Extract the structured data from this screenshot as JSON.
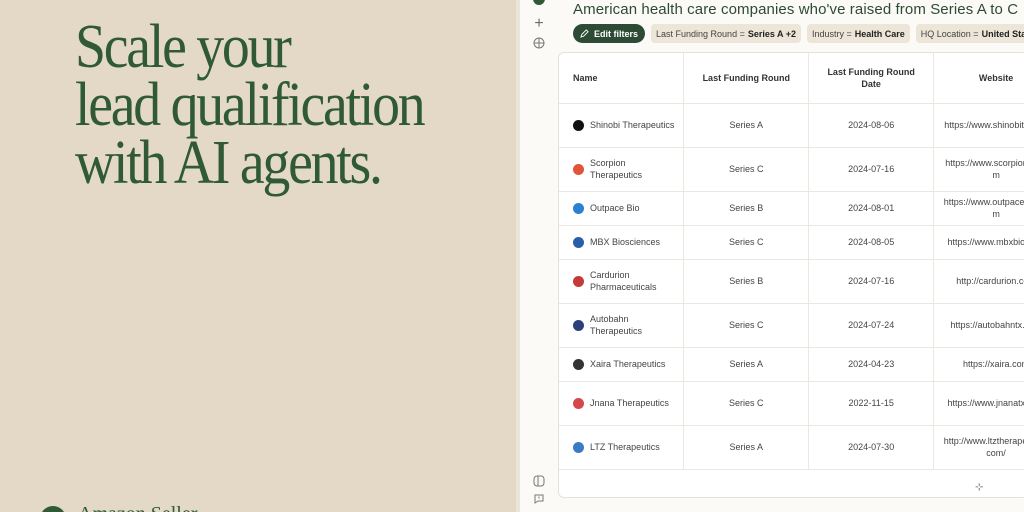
{
  "hero": {
    "line1": "Scale your",
    "line2": "lead qualification",
    "line3": "with AI agents.",
    "brand": "Amazon Seller"
  },
  "app": {
    "title": "American health care companies who've raised from Series A to C",
    "filters": {
      "edit_label": "Edit filters",
      "chips": [
        {
          "key": "Last Funding Round =",
          "value": "Series A +2"
        },
        {
          "key": "Industry =",
          "value": "Health Care"
        },
        {
          "key": "HQ Location =",
          "value": "United States"
        }
      ]
    },
    "table": {
      "columns": [
        "Name",
        "Last Funding Round",
        "Last Funding Round Date",
        "Website"
      ],
      "rows": [
        {
          "name": "Shinobi Therapeutics",
          "round": "Series A",
          "date": "2024-08-06",
          "website": "https://www.shinobitx.com",
          "logo": "shinobi-logo",
          "logo_color": "#111111"
        },
        {
          "name": "Scorpion Therapeutics",
          "round": "Series C",
          "date": "2024-07-16",
          "website": "https://www.scorpiontx.com",
          "logo": "scorpion-logo",
          "logo_color": "#e0553a"
        },
        {
          "name": "Outpace Bio",
          "round": "Series B",
          "date": "2024-08-01",
          "website": "https://www.outpacebio.com",
          "logo": "outpace-logo",
          "logo_color": "#2d7fd0"
        },
        {
          "name": "MBX Biosciences",
          "round": "Series C",
          "date": "2024-08-05",
          "website": "https://www.mbxbio.com",
          "logo": "mbx-logo",
          "logo_color": "#2a5ea8"
        },
        {
          "name": "Cardurion Pharmaceuticals",
          "round": "Series B",
          "date": "2024-07-16",
          "website": "http://cardurion.com",
          "logo": "cardurion-logo",
          "logo_color": "#c43a3a"
        },
        {
          "name": "Autobahn Therapeutics",
          "round": "Series C",
          "date": "2024-07-24",
          "website": "https://autobahntx.com",
          "logo": "autobahn-logo",
          "logo_color": "#2c3f7a"
        },
        {
          "name": "Xaira Therapeutics",
          "round": "Series A",
          "date": "2024-04-23",
          "website": "https://xaira.com",
          "logo": "xaira-logo",
          "logo_color": "#333333"
        },
        {
          "name": "Jnana Therapeutics",
          "round": "Series C",
          "date": "2022-11-15",
          "website": "https://www.jnanatx.com",
          "logo": "jnana-logo",
          "logo_color": "#d2484b"
        },
        {
          "name": "LTZ Therapeutics",
          "round": "Series A",
          "date": "2024-07-30",
          "website": "http://www.ltztherapeutics.com/",
          "logo": "ltz-logo",
          "logo_color": "#3b7bc4"
        }
      ]
    }
  },
  "colors": {
    "accent_green": "#2f5a34",
    "left_background": "#e3d9c6",
    "chip_background": "#ece5d8"
  }
}
